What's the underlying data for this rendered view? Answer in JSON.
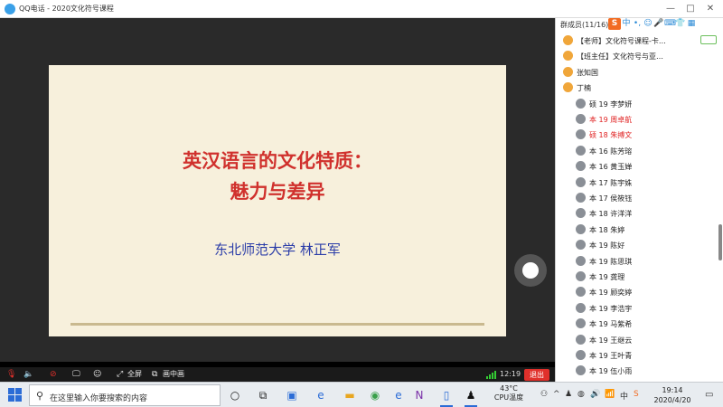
{
  "window": {
    "title": "QQ电话 - 2020文化符号课程",
    "controls": [
      "—",
      "□",
      "✕"
    ]
  },
  "slide": {
    "title_line1": "英汉语言的文化特质：",
    "title_line2": "魅力与差异",
    "author": "东北师范大学 林正军"
  },
  "control_bar": {
    "fullscreen_label": "全屏",
    "pip_label": "画中画",
    "time": "12:19",
    "exit_label": "退出"
  },
  "panel": {
    "member_count": "群成员(11/16)",
    "members": [
      {
        "name": "【老师】文化符号课程-卡…",
        "avatar": "person-icon",
        "muted_mic": true,
        "red": false
      },
      {
        "name": "【班主任】文化符号与亚…",
        "avatar": "person-icon",
        "muted_mic": false,
        "red": false
      },
      {
        "name": "张知国",
        "avatar": "person-icon",
        "muted_mic": false,
        "red": false
      },
      {
        "name": "丁楠",
        "avatar": "person-icon",
        "muted_mic": false,
        "red": false
      },
      {
        "name": "硕 19 李梦妍",
        "avatar": "avatar-photo",
        "red": false
      },
      {
        "name": "本 19 周卓航",
        "avatar": "avatar-photo",
        "red": true
      },
      {
        "name": "硕 18 朱搏文",
        "avatar": "avatar-photo",
        "red": true
      },
      {
        "name": "本 16 陈芳瑢",
        "avatar": "avatar-photo",
        "red": false
      },
      {
        "name": "本 16 黄玉婵",
        "avatar": "avatar-photo",
        "red": false
      },
      {
        "name": "本 17 陈宇姝",
        "avatar": "avatar-photo",
        "red": false
      },
      {
        "name": "本 17 侯筱钰",
        "avatar": "avatar-photo",
        "red": false
      },
      {
        "name": "本 18 许洋洋",
        "avatar": "avatar-photo",
        "red": false
      },
      {
        "name": "本 18 朱婷",
        "avatar": "avatar-photo",
        "red": false
      },
      {
        "name": "本 19 陈好",
        "avatar": "avatar-photo",
        "red": false
      },
      {
        "name": "本 19 陈思琪",
        "avatar": "avatar-photo",
        "red": false
      },
      {
        "name": "本 19 龚理",
        "avatar": "avatar-photo",
        "red": false
      },
      {
        "name": "本 19 顾奕婷",
        "avatar": "avatar-photo",
        "red": false
      },
      {
        "name": "本 19 李浩宇",
        "avatar": "avatar-photo",
        "red": false
      },
      {
        "name": "本 19 马紫希",
        "avatar": "avatar-photo",
        "red": false
      },
      {
        "name": "本 19 王继云",
        "avatar": "avatar-photo",
        "red": false
      },
      {
        "name": "本 19 王叶青",
        "avatar": "avatar-photo",
        "red": false
      },
      {
        "name": "本 19 伍小雨",
        "avatar": "avatar-photo",
        "red": false
      }
    ]
  },
  "taskbar": {
    "search_placeholder": "在这里输入你要搜索的内容",
    "weather_temp": "43°C",
    "weather_label": "CPU温度",
    "ime_label": "中",
    "clock_time": "19:14",
    "clock_date": "2020/4/20"
  },
  "colors": {
    "accent_red": "#e02222",
    "exit_red": "#e0302b",
    "slide_bg": "#f7f0dc",
    "slide_title": "#d0312d",
    "slide_author": "#2b3da8"
  }
}
